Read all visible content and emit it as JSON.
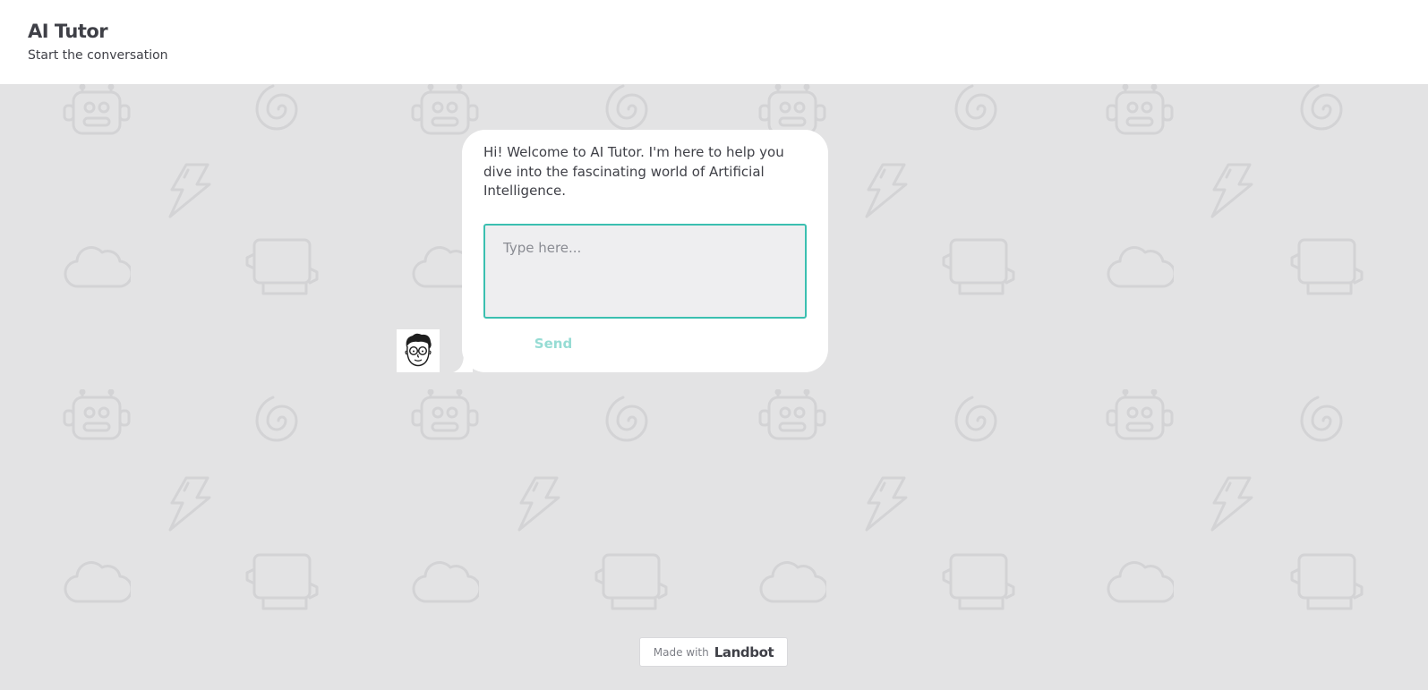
{
  "header": {
    "title": "AI Tutor",
    "subtitle": "Start the conversation"
  },
  "chat": {
    "message": "Hi! Welcome to AI Tutor. I'm here to help you dive into the fascinating world of Artificial Intelligence.",
    "input_placeholder": "Type here...",
    "input_value": "",
    "send_label": "Send"
  },
  "badge": {
    "made_with": "Made with",
    "brand": "Landbot"
  },
  "colors": {
    "accent": "#3bbfb0",
    "send_disabled": "#96dcd4",
    "background": "#e3e3e4",
    "pattern": "#d3d3d5",
    "text": "#3f4047"
  },
  "icons": {
    "background_pattern": [
      "robot-icon",
      "spiral-icon",
      "lightning-icon",
      "cloud-icon",
      "monitor-icon"
    ],
    "avatar": "tutor-avatar"
  }
}
